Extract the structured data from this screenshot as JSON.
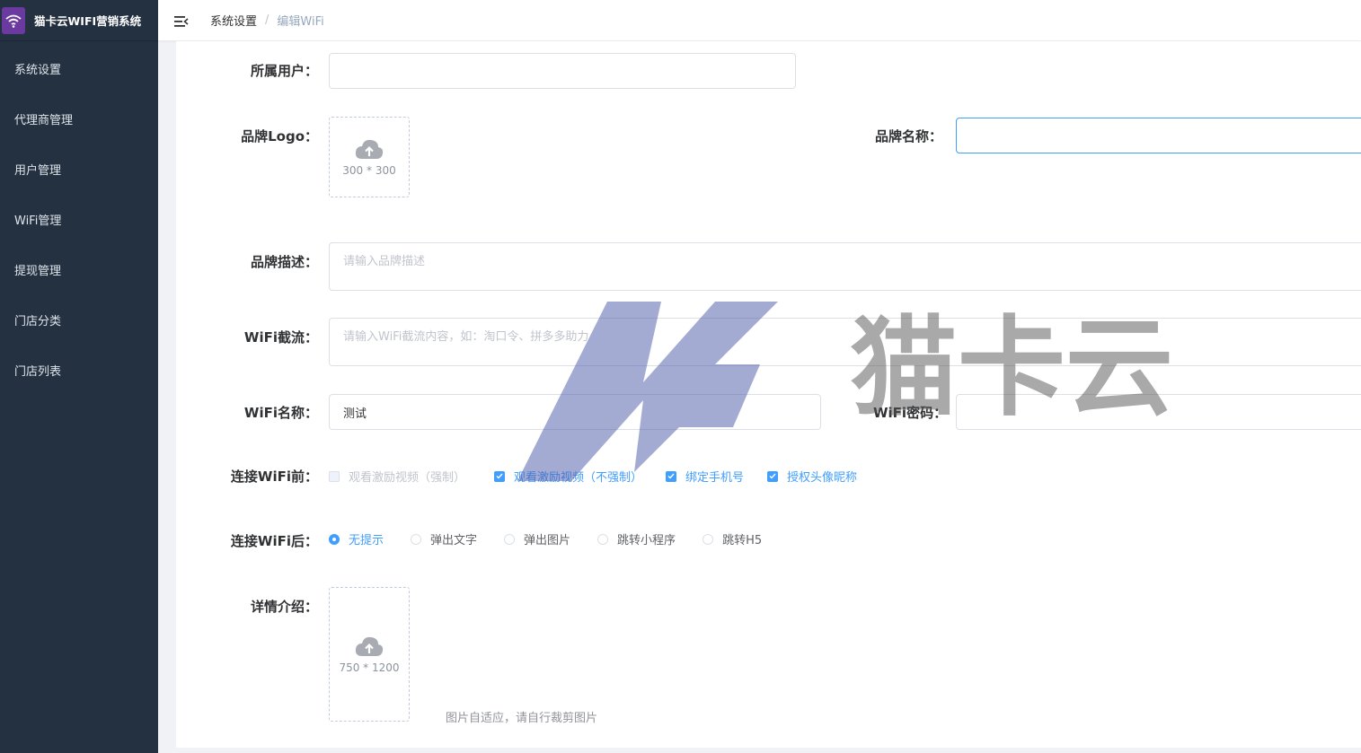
{
  "app": {
    "title": "猫卡云WIFI营销系统",
    "logo_icon": "wifi-icon"
  },
  "sidebar": {
    "items": [
      {
        "label": "系统设置"
      },
      {
        "label": "代理商管理"
      },
      {
        "label": "用户管理"
      },
      {
        "label": "WiFi管理"
      },
      {
        "label": "提现管理"
      },
      {
        "label": "门店分类"
      },
      {
        "label": "门店列表"
      }
    ]
  },
  "header": {
    "menu_toggle_icon": "menu-fold-icon",
    "breadcrumb": [
      "系统设置",
      "编辑WiFi"
    ],
    "separator": "/"
  },
  "form": {
    "owner_user": {
      "label": "所属用户：",
      "value": ""
    },
    "brand_logo": {
      "label": "品牌Logo：",
      "size_hint": "300 * 300"
    },
    "brand_name": {
      "label": "品牌名称：",
      "value": ""
    },
    "brand_desc": {
      "label": "品牌描述：",
      "placeholder": "请输入品牌描述"
    },
    "wifi_intercept": {
      "label": "WiFi截流：",
      "placeholder": "请输入WiFi截流内容，如：淘口令、拼多多助力"
    },
    "wifi_name": {
      "label": "WiFi名称：",
      "value": "测试"
    },
    "wifi_password": {
      "label": "WiFi密码：",
      "value": ""
    },
    "before_connect": {
      "label": "连接WiFi前：",
      "options": [
        {
          "label": "观看激励视频（强制）",
          "checked": false,
          "disabled": true
        },
        {
          "label": "观看激励视频（不强制）",
          "checked": true,
          "disabled": false
        },
        {
          "label": "绑定手机号",
          "checked": true,
          "disabled": false
        },
        {
          "label": "授权头像昵称",
          "checked": true,
          "disabled": false
        }
      ]
    },
    "after_connect": {
      "label": "连接WiFi后：",
      "options": [
        {
          "label": "无提示",
          "checked": true
        },
        {
          "label": "弹出文字",
          "checked": false
        },
        {
          "label": "弹出图片",
          "checked": false
        },
        {
          "label": "跳转小程序",
          "checked": false
        },
        {
          "label": "跳转H5",
          "checked": false
        }
      ],
      "selected": "无提示"
    },
    "detail": {
      "label": "详情介绍：",
      "size_hint": "750 * 1200",
      "tip": "图片自适应，请自行裁剪图片"
    }
  },
  "watermark": {
    "brand_letters": "MK",
    "brand_text": "猫卡云"
  },
  "colors": {
    "sidebar_bg": "#243141",
    "primary": "#409eff",
    "logo_bg": "#6b3aa0"
  }
}
